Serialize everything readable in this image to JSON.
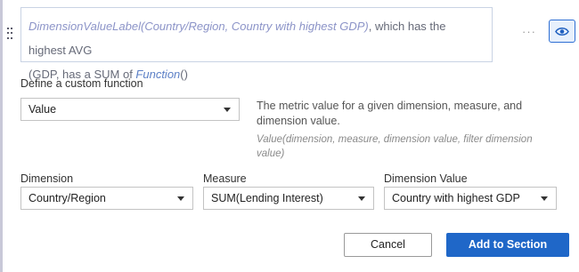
{
  "expression": {
    "function_label": "DimensionValueLabel(Country/Region, Country with highest GDP)",
    "text_part1": ", which has the highest AVG",
    "text_part2": "(GDP, has a SUM of ",
    "function_link": "Function",
    "text_part3": "()"
  },
  "toolbar": {
    "more_label": "···"
  },
  "custom_function": {
    "heading": "Define a custom function",
    "selected": "Value",
    "description": "The metric value for a given dimension, measure, and dimension value.",
    "signature": "Value(dimension, measure, dimension value, filter dimension value)"
  },
  "fields": {
    "dimension": {
      "label": "Dimension",
      "value": "Country/Region"
    },
    "measure": {
      "label": "Measure",
      "value": "SUM(Lending Interest)"
    },
    "dimension_value": {
      "label": "Dimension Value",
      "value": "Country with highest GDP"
    }
  },
  "actions": {
    "cancel_label": "Cancel",
    "add_label": "Add to Section"
  },
  "colors": {
    "accent": "#1f67c8",
    "function_text": "#8c94c8"
  },
  "icons": [
    "drag-handle-icon",
    "more-icon",
    "eye-icon",
    "chevron-down-icon"
  ]
}
